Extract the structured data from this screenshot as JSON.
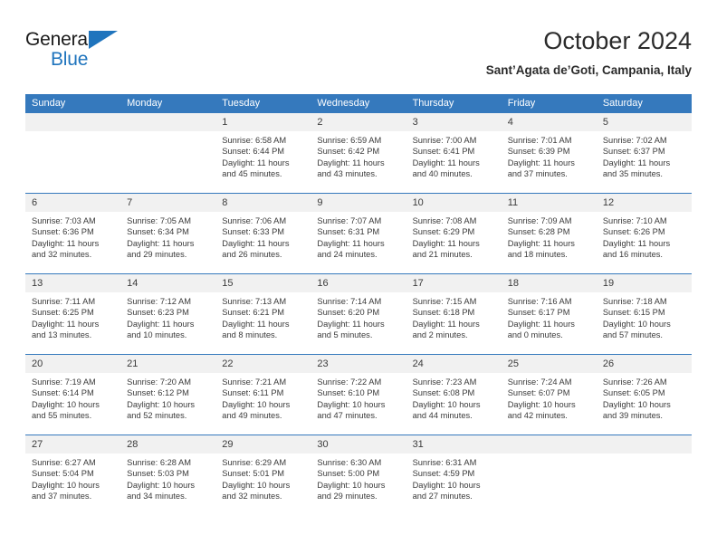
{
  "logo": {
    "word_top": "General",
    "word_bottom": "Blue",
    "triangle_icon": "triangle-icon",
    "brand_color": "#1f74bd"
  },
  "header": {
    "title": "October 2024",
    "subtitle": "Sant’Agata de’Goti, Campania, Italy"
  },
  "theme": {
    "header_blue": "#3579bd",
    "daynum_band": "#f1f1f1",
    "text": "#3a3a3a"
  },
  "calendar": {
    "weekday_headers": [
      "Sunday",
      "Monday",
      "Tuesday",
      "Wednesday",
      "Thursday",
      "Friday",
      "Saturday"
    ],
    "weeks": [
      [
        {
          "day": "",
          "lines": []
        },
        {
          "day": "",
          "lines": []
        },
        {
          "day": "1",
          "lines": [
            "Sunrise: 6:58 AM",
            "Sunset: 6:44 PM",
            "Daylight: 11 hours",
            "and 45 minutes."
          ]
        },
        {
          "day": "2",
          "lines": [
            "Sunrise: 6:59 AM",
            "Sunset: 6:42 PM",
            "Daylight: 11 hours",
            "and 43 minutes."
          ]
        },
        {
          "day": "3",
          "lines": [
            "Sunrise: 7:00 AM",
            "Sunset: 6:41 PM",
            "Daylight: 11 hours",
            "and 40 minutes."
          ]
        },
        {
          "day": "4",
          "lines": [
            "Sunrise: 7:01 AM",
            "Sunset: 6:39 PM",
            "Daylight: 11 hours",
            "and 37 minutes."
          ]
        },
        {
          "day": "5",
          "lines": [
            "Sunrise: 7:02 AM",
            "Sunset: 6:37 PM",
            "Daylight: 11 hours",
            "and 35 minutes."
          ]
        }
      ],
      [
        {
          "day": "6",
          "lines": [
            "Sunrise: 7:03 AM",
            "Sunset: 6:36 PM",
            "Daylight: 11 hours",
            "and 32 minutes."
          ]
        },
        {
          "day": "7",
          "lines": [
            "Sunrise: 7:05 AM",
            "Sunset: 6:34 PM",
            "Daylight: 11 hours",
            "and 29 minutes."
          ]
        },
        {
          "day": "8",
          "lines": [
            "Sunrise: 7:06 AM",
            "Sunset: 6:33 PM",
            "Daylight: 11 hours",
            "and 26 minutes."
          ]
        },
        {
          "day": "9",
          "lines": [
            "Sunrise: 7:07 AM",
            "Sunset: 6:31 PM",
            "Daylight: 11 hours",
            "and 24 minutes."
          ]
        },
        {
          "day": "10",
          "lines": [
            "Sunrise: 7:08 AM",
            "Sunset: 6:29 PM",
            "Daylight: 11 hours",
            "and 21 minutes."
          ]
        },
        {
          "day": "11",
          "lines": [
            "Sunrise: 7:09 AM",
            "Sunset: 6:28 PM",
            "Daylight: 11 hours",
            "and 18 minutes."
          ]
        },
        {
          "day": "12",
          "lines": [
            "Sunrise: 7:10 AM",
            "Sunset: 6:26 PM",
            "Daylight: 11 hours",
            "and 16 minutes."
          ]
        }
      ],
      [
        {
          "day": "13",
          "lines": [
            "Sunrise: 7:11 AM",
            "Sunset: 6:25 PM",
            "Daylight: 11 hours",
            "and 13 minutes."
          ]
        },
        {
          "day": "14",
          "lines": [
            "Sunrise: 7:12 AM",
            "Sunset: 6:23 PM",
            "Daylight: 11 hours",
            "and 10 minutes."
          ]
        },
        {
          "day": "15",
          "lines": [
            "Sunrise: 7:13 AM",
            "Sunset: 6:21 PM",
            "Daylight: 11 hours",
            "and 8 minutes."
          ]
        },
        {
          "day": "16",
          "lines": [
            "Sunrise: 7:14 AM",
            "Sunset: 6:20 PM",
            "Daylight: 11 hours",
            "and 5 minutes."
          ]
        },
        {
          "day": "17",
          "lines": [
            "Sunrise: 7:15 AM",
            "Sunset: 6:18 PM",
            "Daylight: 11 hours",
            "and 2 minutes."
          ]
        },
        {
          "day": "18",
          "lines": [
            "Sunrise: 7:16 AM",
            "Sunset: 6:17 PM",
            "Daylight: 11 hours",
            "and 0 minutes."
          ]
        },
        {
          "day": "19",
          "lines": [
            "Sunrise: 7:18 AM",
            "Sunset: 6:15 PM",
            "Daylight: 10 hours",
            "and 57 minutes."
          ]
        }
      ],
      [
        {
          "day": "20",
          "lines": [
            "Sunrise: 7:19 AM",
            "Sunset: 6:14 PM",
            "Daylight: 10 hours",
            "and 55 minutes."
          ]
        },
        {
          "day": "21",
          "lines": [
            "Sunrise: 7:20 AM",
            "Sunset: 6:12 PM",
            "Daylight: 10 hours",
            "and 52 minutes."
          ]
        },
        {
          "day": "22",
          "lines": [
            "Sunrise: 7:21 AM",
            "Sunset: 6:11 PM",
            "Daylight: 10 hours",
            "and 49 minutes."
          ]
        },
        {
          "day": "23",
          "lines": [
            "Sunrise: 7:22 AM",
            "Sunset: 6:10 PM",
            "Daylight: 10 hours",
            "and 47 minutes."
          ]
        },
        {
          "day": "24",
          "lines": [
            "Sunrise: 7:23 AM",
            "Sunset: 6:08 PM",
            "Daylight: 10 hours",
            "and 44 minutes."
          ]
        },
        {
          "day": "25",
          "lines": [
            "Sunrise: 7:24 AM",
            "Sunset: 6:07 PM",
            "Daylight: 10 hours",
            "and 42 minutes."
          ]
        },
        {
          "day": "26",
          "lines": [
            "Sunrise: 7:26 AM",
            "Sunset: 6:05 PM",
            "Daylight: 10 hours",
            "and 39 minutes."
          ]
        }
      ],
      [
        {
          "day": "27",
          "lines": [
            "Sunrise: 6:27 AM",
            "Sunset: 5:04 PM",
            "Daylight: 10 hours",
            "and 37 minutes."
          ]
        },
        {
          "day": "28",
          "lines": [
            "Sunrise: 6:28 AM",
            "Sunset: 5:03 PM",
            "Daylight: 10 hours",
            "and 34 minutes."
          ]
        },
        {
          "day": "29",
          "lines": [
            "Sunrise: 6:29 AM",
            "Sunset: 5:01 PM",
            "Daylight: 10 hours",
            "and 32 minutes."
          ]
        },
        {
          "day": "30",
          "lines": [
            "Sunrise: 6:30 AM",
            "Sunset: 5:00 PM",
            "Daylight: 10 hours",
            "and 29 minutes."
          ]
        },
        {
          "day": "31",
          "lines": [
            "Sunrise: 6:31 AM",
            "Sunset: 4:59 PM",
            "Daylight: 10 hours",
            "and 27 minutes."
          ]
        },
        {
          "day": "",
          "lines": []
        },
        {
          "day": "",
          "lines": []
        }
      ]
    ]
  }
}
